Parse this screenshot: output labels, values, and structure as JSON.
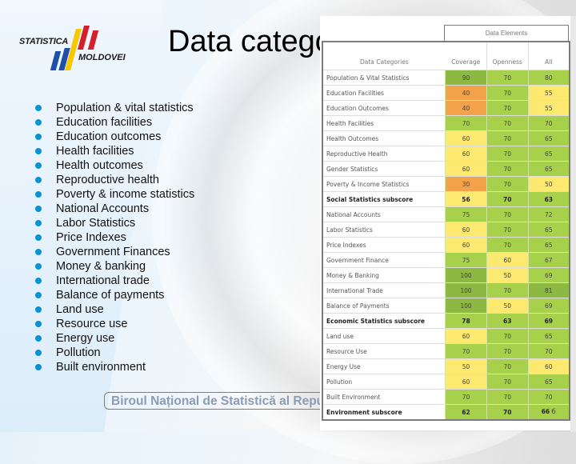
{
  "slide": {
    "title": "Data categories",
    "logo": {
      "line1": "STATISTICA",
      "line2": "MOLDOVEI",
      "colors": {
        "blue": "#1f4fa8",
        "yellow": "#f5c800",
        "red": "#d4202a"
      }
    },
    "bullet_color": "#0a93d4",
    "bullets": [
      "Population & vital statistics",
      "Education facilities",
      "Education outcomes",
      "Health facilities",
      "Health outcomes",
      "Reproductive health",
      "Poverty & income statistics",
      "National Accounts",
      "Labor Statistics",
      "Price Indexes",
      "Government Finances",
      "Money & banking",
      "International trade",
      "Balance of payments",
      "Land use",
      "Resource use",
      "Energy use",
      "Pollution",
      "Built environment"
    ],
    "footer": "Biroul Național de Statistică al Republicii Moldova",
    "page_number": "6"
  },
  "table": {
    "group_header": "Data Elements",
    "columns": [
      "Data Categories",
      "Coverage",
      "Openness",
      "All"
    ],
    "colors": {
      "dark_green": "#8db842",
      "green": "#a8d14b",
      "yellow": "#fde870",
      "orange": "#f4a24a"
    },
    "rows": [
      {
        "category": "Population & Vital Statistics",
        "values": [
          "90",
          "70",
          "80"
        ],
        "colors": [
          "dark_green",
          "green",
          "green"
        ],
        "subscore": false
      },
      {
        "category": "Education Facilities",
        "values": [
          "40",
          "70",
          "55"
        ],
        "colors": [
          "orange",
          "green",
          "yellow"
        ],
        "subscore": false
      },
      {
        "category": "Education Outcomes",
        "values": [
          "40",
          "70",
          "55"
        ],
        "colors": [
          "orange",
          "green",
          "yellow"
        ],
        "subscore": false
      },
      {
        "category": "Health Facilities",
        "values": [
          "70",
          "70",
          "70"
        ],
        "colors": [
          "green",
          "green",
          "green"
        ],
        "subscore": false
      },
      {
        "category": "Health Outcomes",
        "values": [
          "60",
          "70",
          "65"
        ],
        "colors": [
          "yellow",
          "green",
          "green"
        ],
        "subscore": false
      },
      {
        "category": "Reproductive Health",
        "values": [
          "60",
          "70",
          "65"
        ],
        "colors": [
          "yellow",
          "green",
          "green"
        ],
        "subscore": false
      },
      {
        "category": "Gender Statistics",
        "values": [
          "60",
          "70",
          "65"
        ],
        "colors": [
          "yellow",
          "green",
          "green"
        ],
        "subscore": false
      },
      {
        "category": "Poverty & Income Statistics",
        "values": [
          "30",
          "70",
          "50"
        ],
        "colors": [
          "orange",
          "green",
          "yellow"
        ],
        "subscore": false
      },
      {
        "category": "Social Statistics subscore",
        "values": [
          "56",
          "70",
          "63"
        ],
        "colors": [
          "yellow",
          "green",
          "green"
        ],
        "subscore": true
      },
      {
        "category": "National Accounts",
        "values": [
          "75",
          "70",
          "72"
        ],
        "colors": [
          "green",
          "green",
          "green"
        ],
        "subscore": false
      },
      {
        "category": "Labor Statistics",
        "values": [
          "60",
          "70",
          "65"
        ],
        "colors": [
          "yellow",
          "green",
          "green"
        ],
        "subscore": false
      },
      {
        "category": "Price Indexes",
        "values": [
          "60",
          "70",
          "65"
        ],
        "colors": [
          "yellow",
          "green",
          "green"
        ],
        "subscore": false
      },
      {
        "category": "Government Finance",
        "values": [
          "75",
          "60",
          "67"
        ],
        "colors": [
          "green",
          "yellow",
          "green"
        ],
        "subscore": false
      },
      {
        "category": "Money & Banking",
        "values": [
          "100",
          "50",
          "69"
        ],
        "colors": [
          "dark_green",
          "yellow",
          "green"
        ],
        "subscore": false
      },
      {
        "category": "International Trade",
        "values": [
          "100",
          "70",
          "81"
        ],
        "colors": [
          "dark_green",
          "green",
          "dark_green"
        ],
        "subscore": false
      },
      {
        "category": "Balance of Payments",
        "values": [
          "100",
          "50",
          "69"
        ],
        "colors": [
          "dark_green",
          "yellow",
          "green"
        ],
        "subscore": false
      },
      {
        "category": "Economic Statistics subscore",
        "values": [
          "78",
          "63",
          "69"
        ],
        "colors": [
          "green",
          "green",
          "green"
        ],
        "subscore": true
      },
      {
        "category": "Land use",
        "values": [
          "60",
          "70",
          "65"
        ],
        "colors": [
          "yellow",
          "green",
          "green"
        ],
        "subscore": false
      },
      {
        "category": "Resource Use",
        "values": [
          "70",
          "70",
          "70"
        ],
        "colors": [
          "green",
          "green",
          "green"
        ],
        "subscore": false
      },
      {
        "category": "Energy Use",
        "values": [
          "50",
          "70",
          "60"
        ],
        "colors": [
          "yellow",
          "green",
          "yellow"
        ],
        "subscore": false
      },
      {
        "category": "Pollution",
        "values": [
          "60",
          "70",
          "65"
        ],
        "colors": [
          "yellow",
          "green",
          "green"
        ],
        "subscore": false
      },
      {
        "category": "Built Environment",
        "values": [
          "70",
          "70",
          "70"
        ],
        "colors": [
          "green",
          "green",
          "green"
        ],
        "subscore": false
      },
      {
        "category": "Environment subscore",
        "values": [
          "62",
          "70",
          "66"
        ],
        "colors": [
          "green",
          "green",
          "green"
        ],
        "subscore": true
      }
    ]
  }
}
